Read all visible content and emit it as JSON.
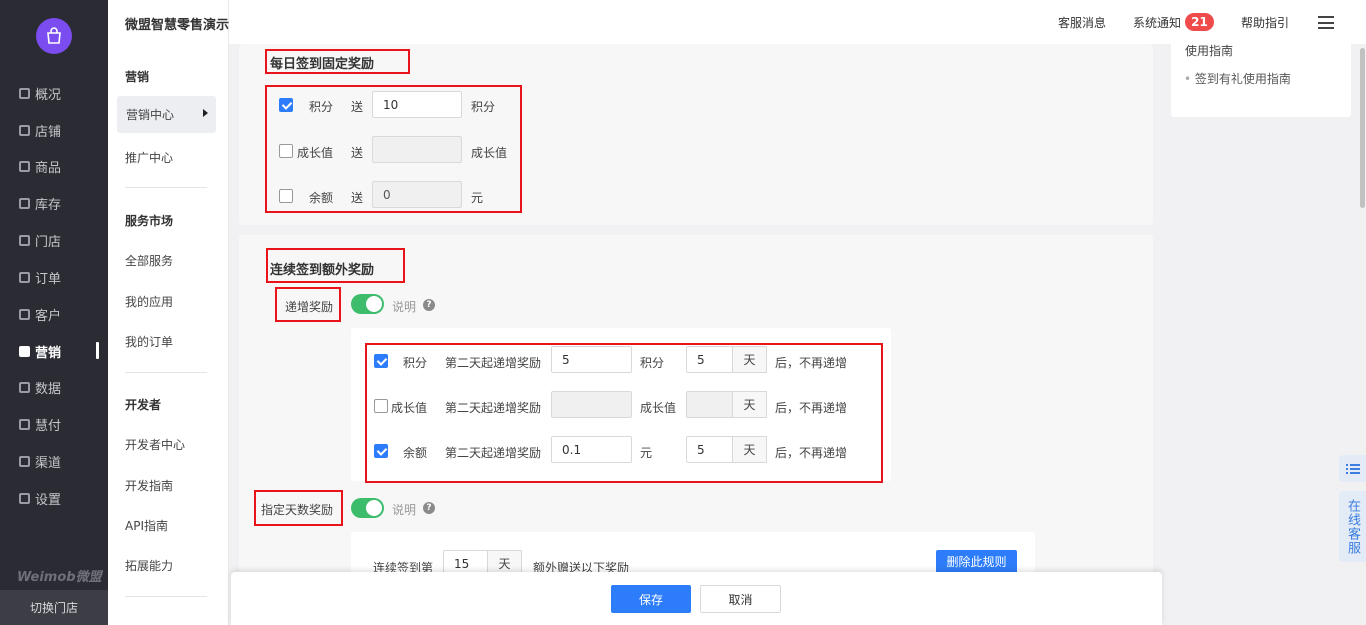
{
  "sidebar": {
    "items": [
      {
        "label": "概况",
        "icon": "overview-icon"
      },
      {
        "label": "店铺",
        "icon": "shop-icon"
      },
      {
        "label": "商品",
        "icon": "goods-icon"
      },
      {
        "label": "库存",
        "icon": "inventory-icon"
      },
      {
        "label": "门店",
        "icon": "store-icon"
      },
      {
        "label": "订单",
        "icon": "order-icon"
      },
      {
        "label": "客户",
        "icon": "customer-icon"
      },
      {
        "label": "营销",
        "icon": "marketing-icon",
        "active": true
      },
      {
        "label": "数据",
        "icon": "data-icon"
      },
      {
        "label": "慧付",
        "icon": "pay-icon"
      },
      {
        "label": "渠道",
        "icon": "channel-icon"
      },
      {
        "label": "设置",
        "icon": "settings-icon"
      }
    ],
    "brand": "Weimob微盟",
    "switch_store": "切换门店"
  },
  "header": {
    "shop_name": "微盟智慧零售演示账号",
    "service_msg": "客服消息",
    "system_notice": "系统通知",
    "notice_count": "21",
    "help": "帮助指引"
  },
  "subnav": {
    "marketing": "营销",
    "marketing_center": "营销中心",
    "promotion_center": "推广中心",
    "service_market": "服务市场",
    "all_services": "全部服务",
    "my_apps": "我的应用",
    "my_orders": "我的订单",
    "developer": "开发者",
    "developer_center": "开发者中心",
    "developer_guide": "开发指南",
    "api_guide": "API指南",
    "extensions": "拓展能力"
  },
  "right_panel": {
    "guide_partial": "使用指南",
    "guide_link": "签到有礼使用指南"
  },
  "daily": {
    "title": "每日签到固定奖励",
    "send": "送",
    "rows": [
      {
        "label": "积分",
        "checked": true,
        "value": "10",
        "unit": "积分",
        "disabled": false
      },
      {
        "label": "成长值",
        "checked": false,
        "value": "",
        "unit": "成长值",
        "disabled": true
      },
      {
        "label": "余额",
        "checked": false,
        "value": "0",
        "unit": "元",
        "disabled": true
      }
    ]
  },
  "continuous": {
    "title": "连续签到额外奖励",
    "incremental_label": "递增奖励",
    "explain": "说明",
    "incremental_on": true,
    "rows": [
      {
        "label": "积分",
        "checked": true,
        "from_text": "第二天起递增奖励",
        "value": "5",
        "unit": "积分",
        "days": "5",
        "day_unit": "天",
        "suffix": "后，不再递增"
      },
      {
        "label": "成长值",
        "checked": false,
        "from_text": "第二天起递增奖励",
        "value": "",
        "unit": "成长值",
        "days": "",
        "day_unit": "天",
        "suffix": "后，不再递增"
      },
      {
        "label": "余额",
        "checked": true,
        "from_text": "第二天起递增奖励",
        "value": "0.1",
        "unit": "元",
        "days": "5",
        "day_unit": "天",
        "suffix": "后，不再递增"
      }
    ],
    "specified_label": "指定天数奖励",
    "specified_on": true,
    "rule_prefix": "连续签到第",
    "rule_days": "15",
    "rule_day_unit": "天",
    "rule_suffix": "额外赠送以下奖励",
    "delete_rule": "删除此规则"
  },
  "footer": {
    "save": "保存",
    "cancel": "取消"
  },
  "float": {
    "online_service": "在线客服"
  },
  "colors": {
    "primary": "#2d7dfa",
    "sidebar_bg": "#2b2c33",
    "toggle_on": "#3dbd6b",
    "highlight_red": "#e8141a",
    "badge_red": "#f04b4b"
  }
}
